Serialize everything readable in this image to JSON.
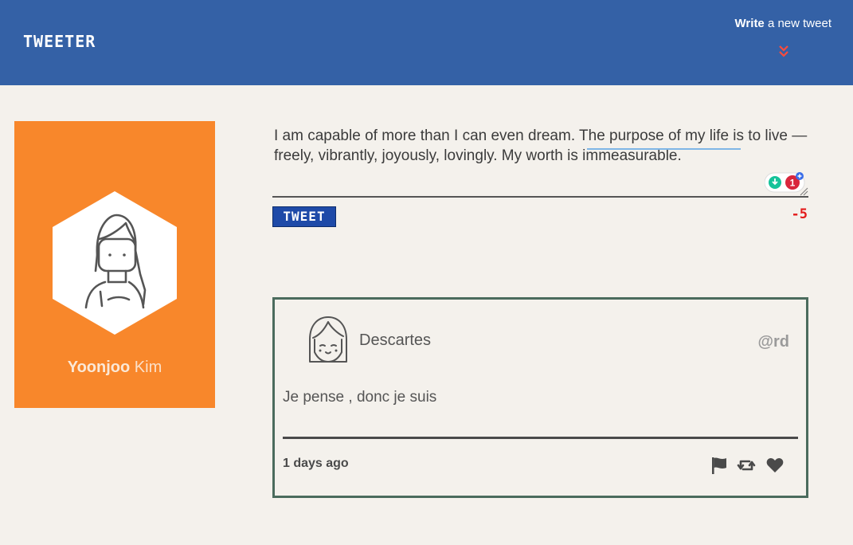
{
  "header": {
    "logo": "TWEETER",
    "write_strong": "Write",
    "write_rest": " a new tweet",
    "chevron_icon": "double-chevron-down-icon"
  },
  "profile": {
    "first_name": "Yoonjoo",
    "last_name": "Kim",
    "card_color": "#f8872b"
  },
  "composer": {
    "text": "I am capable of more than I can even dream.  The purpose of my life is to live — freely, vibrantly, joyously, lovingly. My worth is immeasurable.",
    "button_label": "TWEET",
    "char_count": "-5",
    "grammarly_badge_count": "1"
  },
  "tweet": {
    "author": "Descartes",
    "handle": "@rd",
    "text": "Je pense , donc je suis",
    "time": "1 days ago",
    "actions": [
      "flag-icon",
      "retweet-icon",
      "heart-icon"
    ]
  },
  "colors": {
    "header_bg": "#3461a6",
    "page_bg": "#f4f1ec",
    "tweet_border": "#4b6b5d",
    "count_negative": "#e31b1b"
  }
}
